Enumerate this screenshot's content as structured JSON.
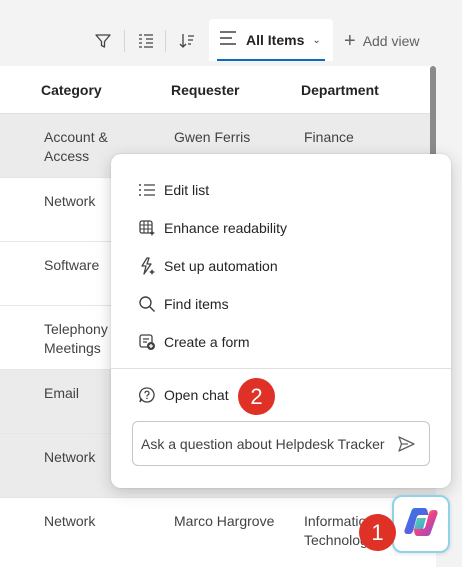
{
  "toolbar": {
    "view_label": "All Items",
    "add_view_label": "Add view",
    "icons": [
      "filter-icon",
      "group-by-icon",
      "sort-icon",
      "view-list-icon",
      "chevron-down-icon",
      "plus-icon"
    ]
  },
  "list": {
    "columns": [
      "Category",
      "Requester",
      "Department"
    ],
    "rows": [
      {
        "category": "Account & Access",
        "requester": "Gwen Ferris",
        "department": "Finance"
      },
      {
        "category": "Network",
        "requester": "",
        "department": ""
      },
      {
        "category": "Software",
        "requester": "",
        "department": ""
      },
      {
        "category": "Telephony Meetings",
        "requester": "",
        "department": ""
      },
      {
        "category": "Email",
        "requester": "",
        "department": ""
      },
      {
        "category": "Network",
        "requester": "",
        "department": ""
      },
      {
        "category": "Network",
        "requester": "Marco Hargrove",
        "department": "Information Technology"
      }
    ]
  },
  "copilot": {
    "menu_items": [
      {
        "label": "Edit list",
        "icon": "list-icon"
      },
      {
        "label": "Enhance readability",
        "icon": "table-sparkle-icon"
      },
      {
        "label": "Set up automation",
        "icon": "automation-flash-icon"
      },
      {
        "label": "Find items",
        "icon": "search-icon"
      },
      {
        "label": "Create a form",
        "icon": "form-add-icon"
      }
    ],
    "open_chat_label": "Open chat",
    "ask_placeholder": "Ask a question about Helpdesk Tracker",
    "send_icon": "send-icon",
    "launcher_icon": "copilot-icon"
  },
  "annotations": {
    "badge1": "1",
    "badge2": "2"
  },
  "colors": {
    "accent": "#0f6cbd",
    "badge": "#e03127",
    "row_shade": "#ebebeb"
  }
}
